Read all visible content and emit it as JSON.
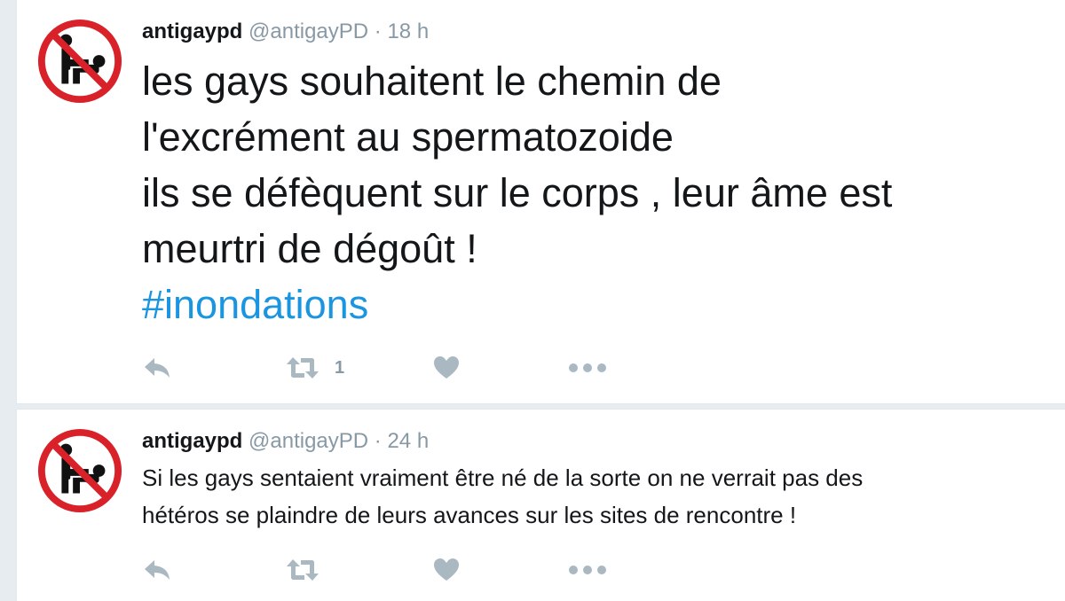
{
  "colors": {
    "text": "#14171a",
    "secondary": "#8899a6",
    "hashtag": "#1b95e0",
    "icon": "#aab8c2",
    "avatar_ring": "#d9212a"
  },
  "tweets": [
    {
      "display_name": "antigaypd",
      "handle": "@antigayPD",
      "separator": "·",
      "time": "18 h",
      "avatar_icon": "prohibition-sign-icon",
      "text_lines": [
        "les gays souhaitent le chemin de",
        "l'excrément au spermatozoide",
        "ils se défèquent sur le corps , leur âme est",
        "meurtri de dégoût !"
      ],
      "hashtag": "#inondations",
      "retweet_count": "1"
    },
    {
      "display_name": "antigaypd",
      "handle": "@antigayPD",
      "separator": "·",
      "time": "24 h",
      "avatar_icon": "prohibition-sign-icon",
      "text_lines": [
        "Si les gays sentaient vraiment être né de la sorte on ne verrait pas des",
        "hétéros se plaindre de leurs avances sur les sites de rencontre !"
      ]
    }
  ]
}
